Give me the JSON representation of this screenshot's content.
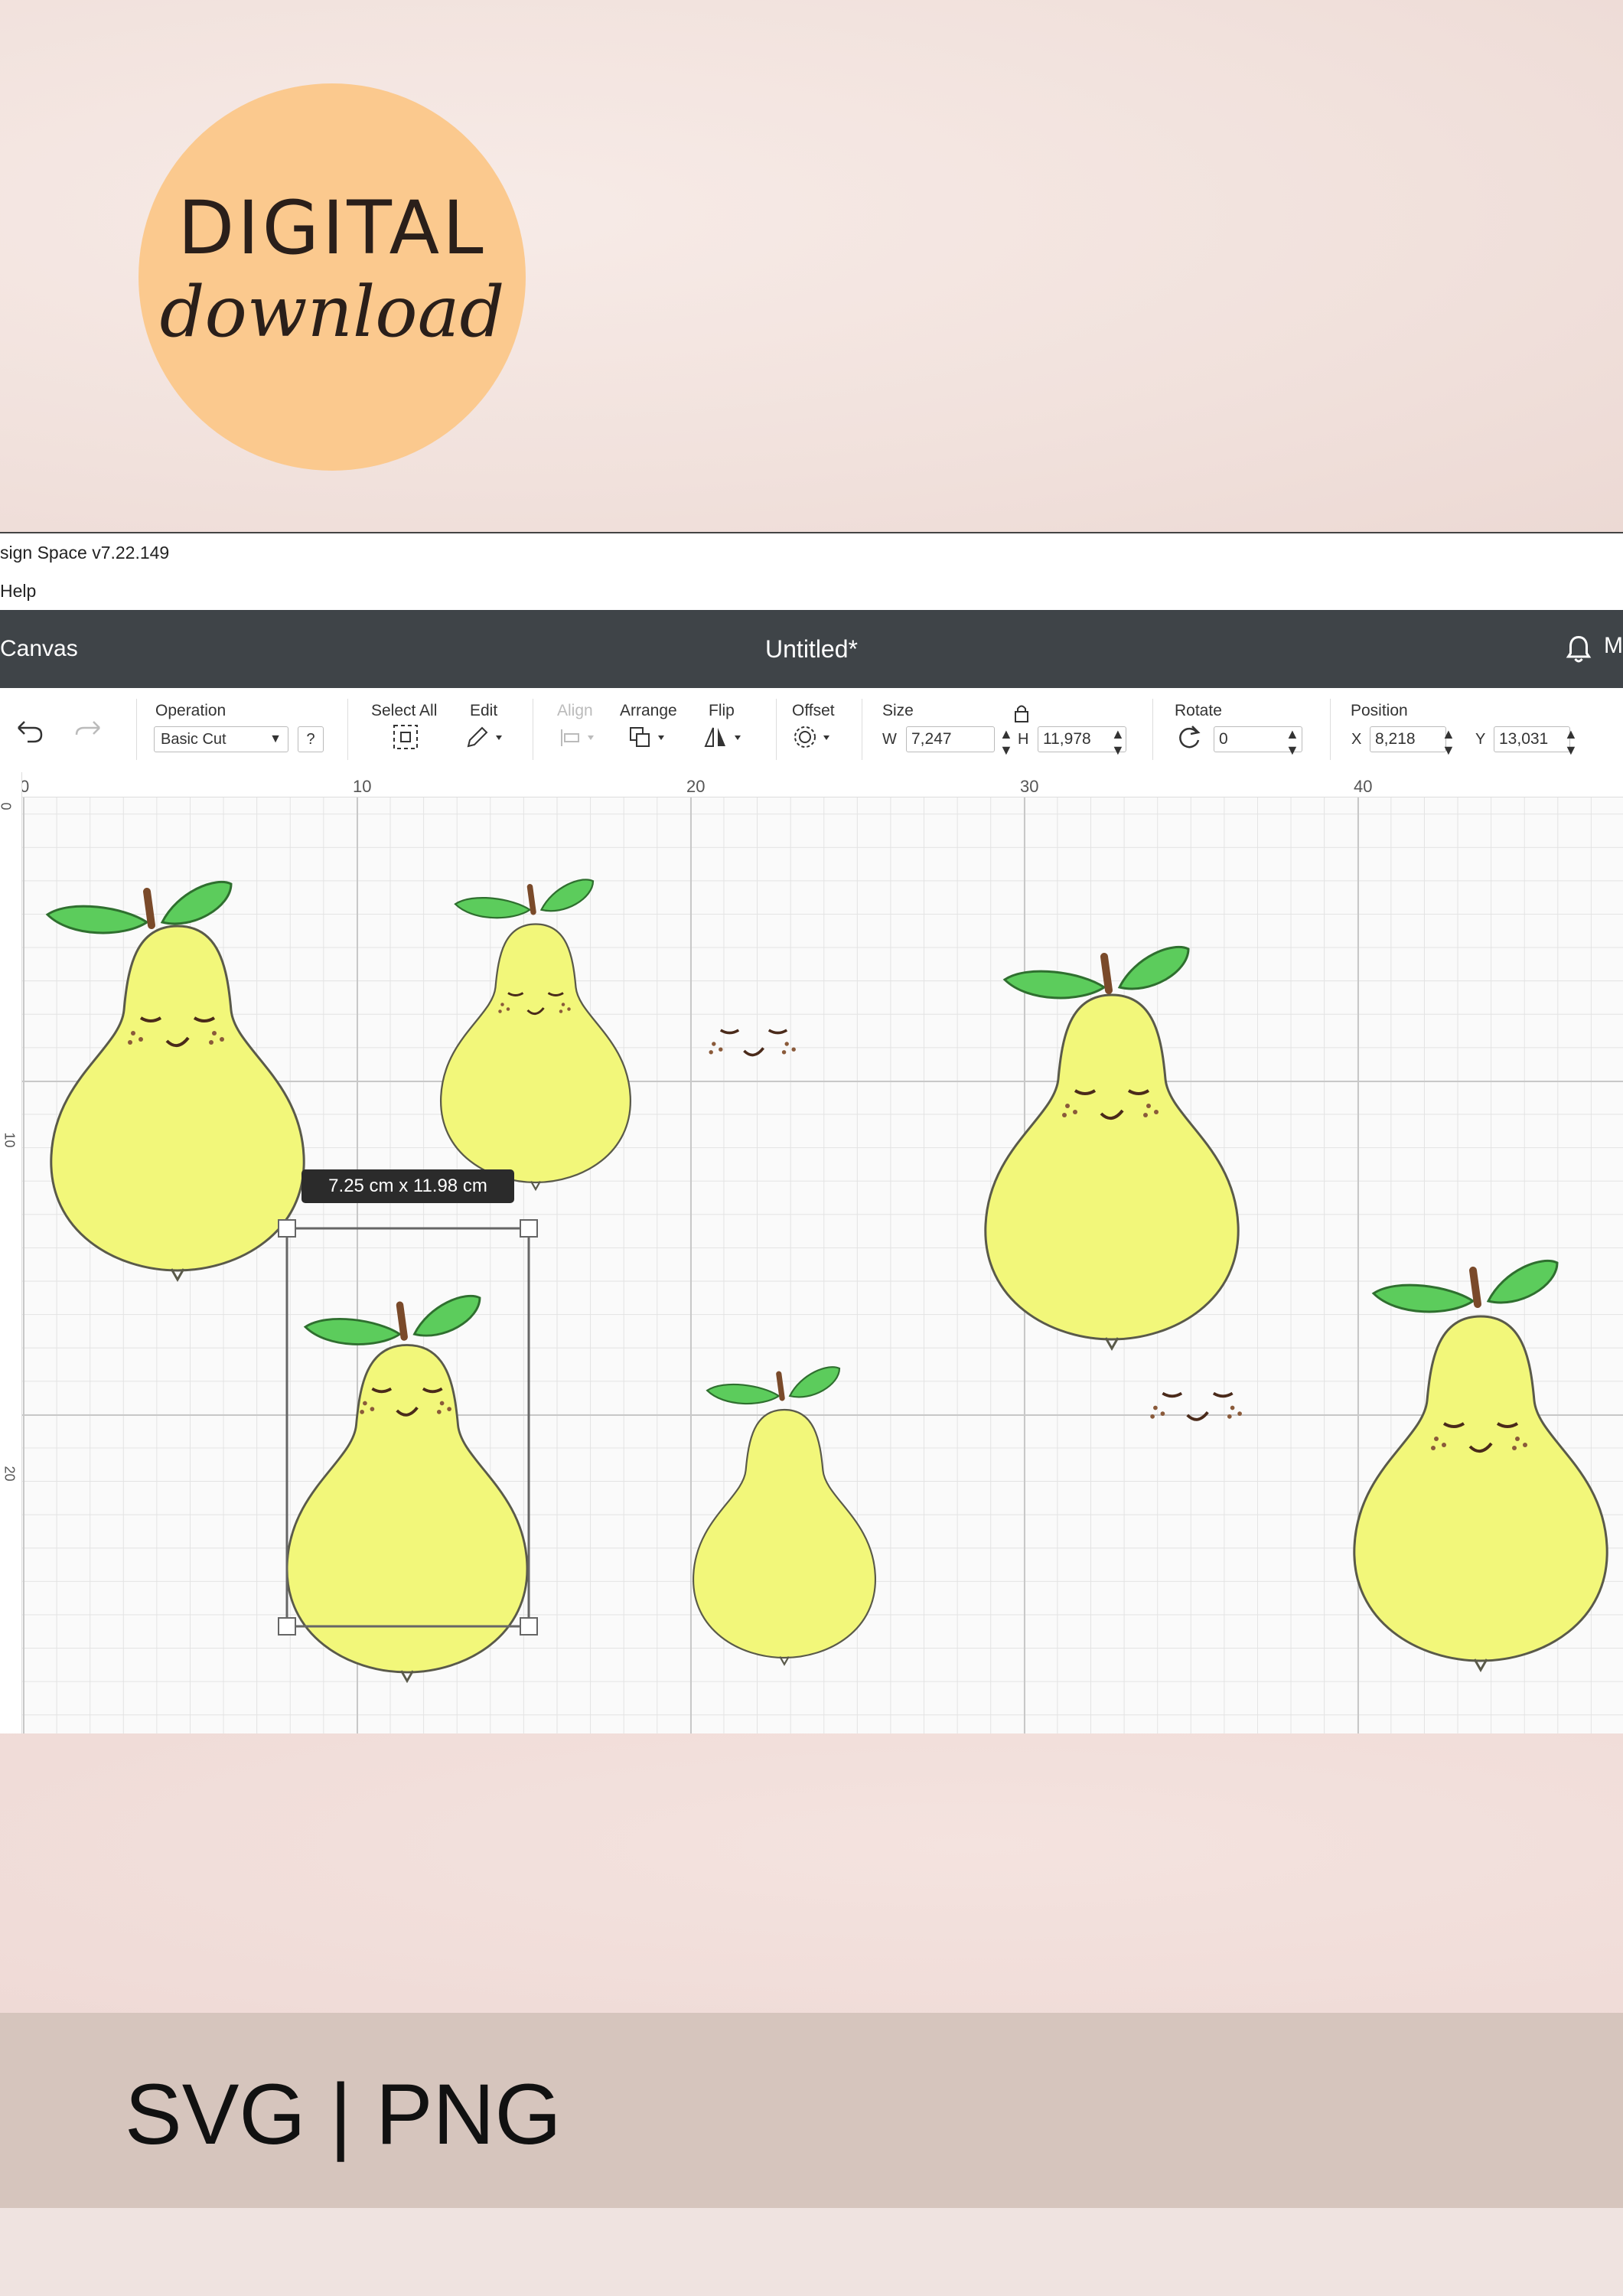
{
  "badge": {
    "line1": "DIGITAL",
    "line2": "download"
  },
  "app": {
    "title": "sign Space  v7.22.149",
    "menu": "Help",
    "canvas_tab": "Canvas",
    "document_title": "Untitled*",
    "user_initial": "M"
  },
  "toolbar": {
    "operation": {
      "label": "Operation",
      "value": "Basic Cut",
      "help": "?"
    },
    "select_all": "Select All",
    "edit": "Edit",
    "align": "Align",
    "arrange": "Arrange",
    "flip": "Flip",
    "offset": "Offset",
    "size": {
      "label": "Size",
      "w_label": "W",
      "w": "7,247",
      "h_label": "H",
      "h": "11,978"
    },
    "rotate": {
      "label": "Rotate",
      "value": "0"
    },
    "position": {
      "label": "Position",
      "x_label": "X",
      "x": "8,218",
      "y_label": "Y",
      "y": "13,031"
    }
  },
  "ruler": {
    "top": [
      "0",
      "10",
      "20",
      "30",
      "40"
    ],
    "left": [
      "0",
      "10",
      "20"
    ]
  },
  "selection_dimensions": "7.25  cm x 11.98  cm",
  "footer": {
    "formats": "SVG | PNG"
  },
  "colors": {
    "pear": "#f2f77a",
    "leaf": "#5ccc5c",
    "stem": "#7a4a2a",
    "header": "#3f4448",
    "badge": "#fbc98e"
  }
}
